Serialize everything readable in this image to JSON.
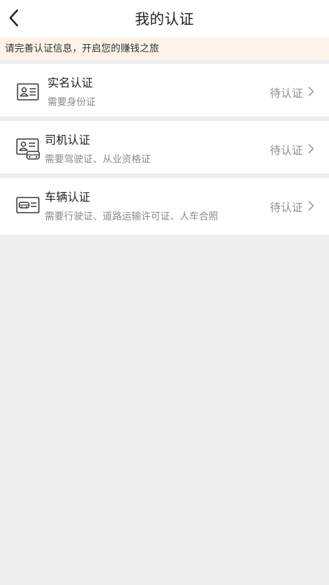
{
  "header": {
    "title": "我的认证"
  },
  "notice": {
    "text": "请完善认证信息，开启您的赚钱之旅"
  },
  "cards": [
    {
      "title": "实名认证",
      "desc": "需要身份证",
      "status": "待认证",
      "icon": "id-card-icon"
    },
    {
      "title": "司机认证",
      "desc": "需要驾驶证、从业资格证",
      "status": "待认证",
      "icon": "driver-license-icon"
    },
    {
      "title": "车辆认证",
      "desc": "需要行驶证、道路运输许可证、人车合照",
      "status": "待认证",
      "icon": "vehicle-license-icon"
    }
  ],
  "colors": {
    "notice_bg": "#fdf3ea",
    "page_bg": "#eeeeee",
    "status_gray": "#8f8f8f"
  }
}
